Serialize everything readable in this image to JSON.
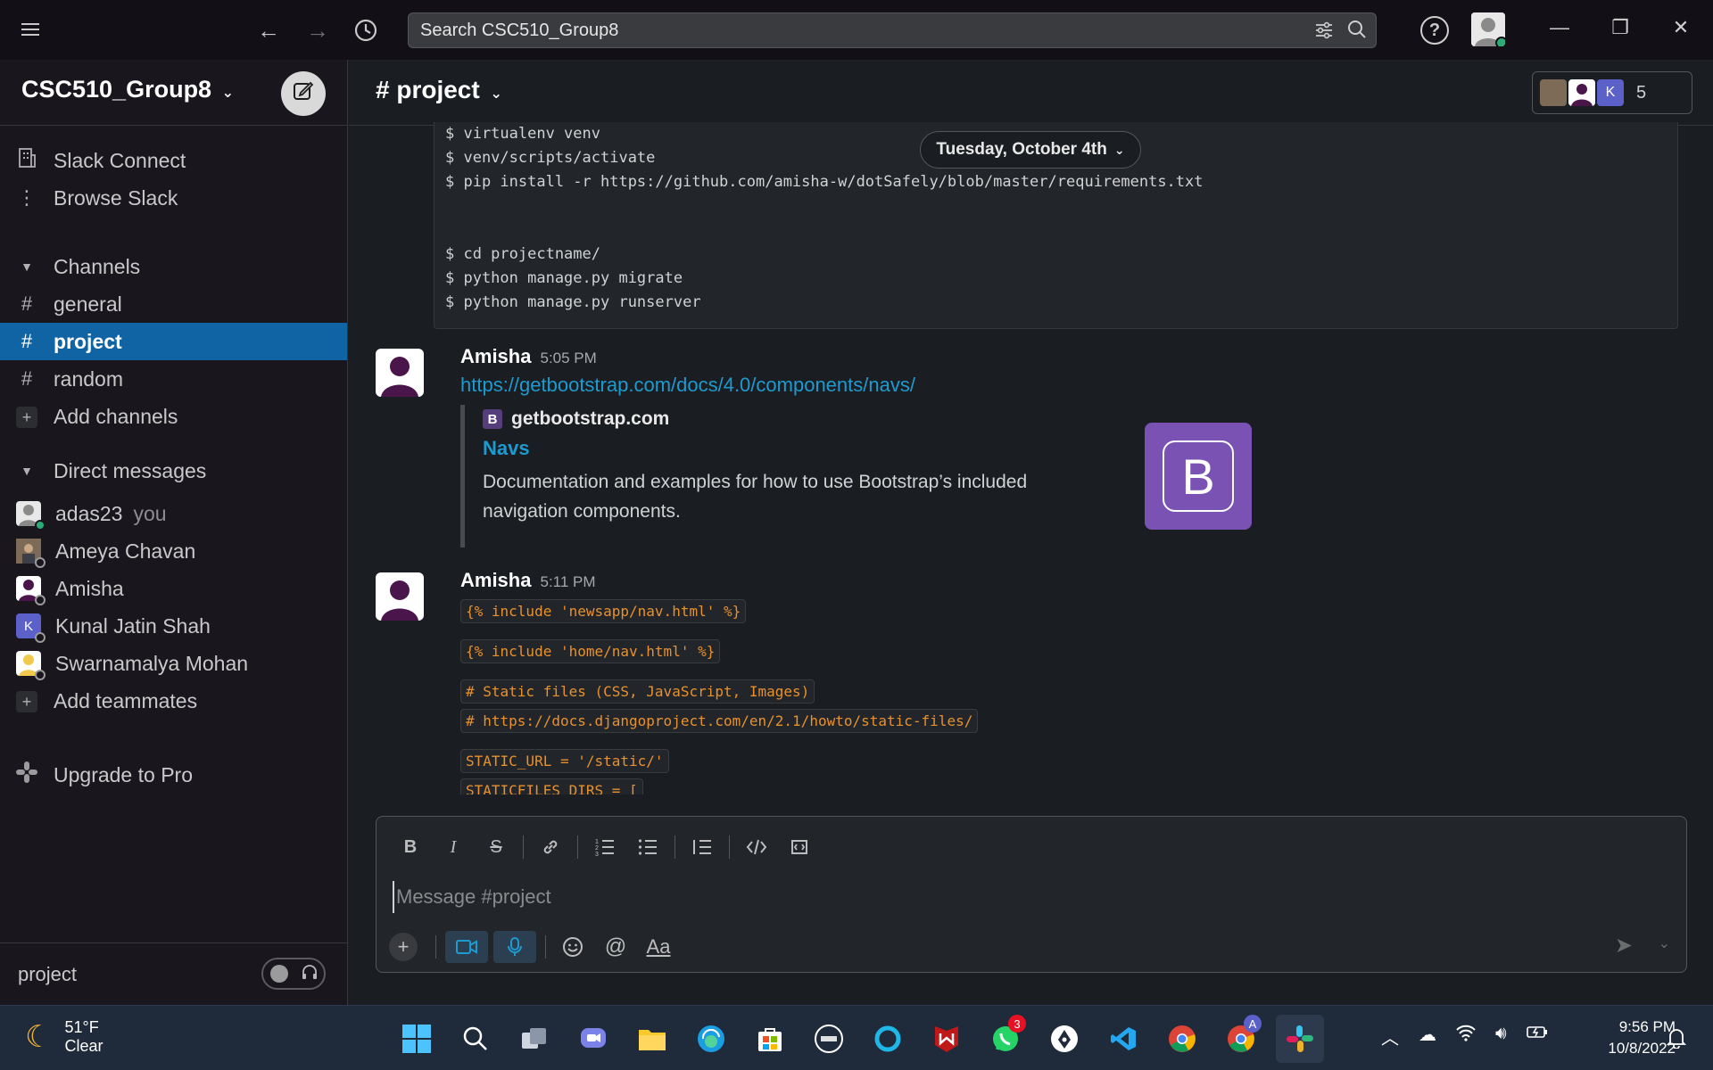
{
  "topbar": {
    "search_text": "Search CSC510_Group8",
    "help_label": "?"
  },
  "sidebar": {
    "workspace_name": "CSC510_Group8",
    "slack_connect": "Slack Connect",
    "browse_slack": "Browse Slack",
    "channels_header": "Channels",
    "channels": [
      {
        "name": "general"
      },
      {
        "name": "project"
      },
      {
        "name": "random"
      }
    ],
    "add_channels": "Add channels",
    "dm_header": "Direct messages",
    "dms": [
      {
        "name": "adas23",
        "suffix": "you",
        "avatar_color": "#e8e8e8",
        "initial": ""
      },
      {
        "name": "Ameya Chavan",
        "avatar_color": "#6b5a4a",
        "initial": ""
      },
      {
        "name": "Amisha",
        "avatar_color": "#ffffff",
        "initial": ""
      },
      {
        "name": "Kunal Jatin Shah",
        "avatar_color": "#5b61c9",
        "initial": "K"
      },
      {
        "name": "Swarnamalya Mohan",
        "avatar_color": "#f2c94c",
        "initial": ""
      }
    ],
    "add_teammates": "Add teammates",
    "upgrade": "Upgrade to Pro",
    "footer_channel": "project"
  },
  "channel": {
    "title": "# project",
    "member_count": "5",
    "member_initial": "K",
    "date_divider": "Tuesday, October 4th"
  },
  "code_block": {
    "lines": [
      "$ virtualenv venv",
      "$ venv/scripts/activate",
      "$ pip install -r https://github.com/amisha-w/dotSafely/blob/master/requirements.txt",
      "",
      "",
      "$ cd projectname/",
      "$ python manage.py migrate",
      "$ python manage.py runserver"
    ]
  },
  "messages": [
    {
      "author": "Amisha",
      "time": "5:05 PM",
      "link": "https://getbootstrap.com/docs/4.0/components/navs/",
      "unfurl": {
        "site_icon": "B",
        "site": "getbootstrap.com",
        "title": "Navs",
        "description": "Documentation and examples for how to use Bootstrap’s included navigation components.",
        "image_letter": "B"
      }
    },
    {
      "author": "Amisha",
      "time": "5:11 PM",
      "code_lines": [
        "{% include 'newsapp/nav.html' %}",
        "{% include 'home/nav.html' %}",
        "# Static files (CSS, JavaScript, Images)",
        "# https://docs.djangoproject.com/en/2.1/howto/static-files/",
        "STATIC_URL = '/static/'",
        "STATICFILES_DIRS = ["
      ]
    }
  ],
  "composer": {
    "placeholder": "Message #project",
    "text_format_label": "Aa"
  },
  "taskbar": {
    "temperature": "51°F",
    "condition": "Clear",
    "whatsapp_badge": "3",
    "chrome_profile_badge": "A",
    "time": "9:56 PM",
    "date": "10/8/2022"
  },
  "colors": {
    "accent": "#1164a3",
    "link": "#1d9bd1",
    "online": "#2bac76",
    "code": "#e8912d"
  }
}
